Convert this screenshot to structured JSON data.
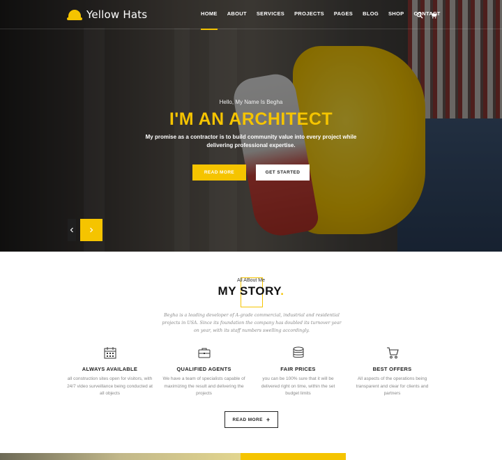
{
  "brand": {
    "name": "Yellow Hats",
    "accent": "#f5c400"
  },
  "nav": {
    "items": [
      "HOME",
      "ABOUT",
      "SERVICES",
      "PROJECTS",
      "PAGES",
      "BLOG",
      "SHOP",
      "CONTACT"
    ],
    "active": "HOME",
    "icons": [
      "search-icon",
      "cart-icon"
    ]
  },
  "hero": {
    "eyebrow": "Hello, My Name Is Begha",
    "title": "I'M AN ARCHITECT",
    "subtitle": "My promise as a contractor is to build community value into every project while delivering professional expertise.",
    "primary_button": "READ MORE",
    "secondary_button": "GET STARTED"
  },
  "story": {
    "eyebrow": "All ABout Me",
    "title": "MY STORY",
    "title_dot": ".",
    "description": "Begha is a leading developer of A-grade commercial, industrial and residential projects in USA. Since its foundation the company has doubled its turnover year on year, with its staff numbers swelling accordingly.",
    "features": [
      {
        "icon": "calendar-icon",
        "title": "ALWAYS AVAILABLE",
        "text": "all construction sites open for visitors, with 24/7 video surveillance being conducted at all objects"
      },
      {
        "icon": "briefcase-icon",
        "title": "QUALIFIED AGENTS",
        "text": "We have a team of specialists capable of maximizing the result and delivering the projects"
      },
      {
        "icon": "database-icon",
        "title": "FAIR PRICES",
        "text": "you can be 100% sure that it will be delivered right on time, within the set budget limits"
      },
      {
        "icon": "cart-icon",
        "title": "BEST OFFERS",
        "text": "All aspects of the operations being transparent and clear for clients and partners"
      }
    ],
    "button": "READ MORE",
    "button_icon": "+"
  }
}
